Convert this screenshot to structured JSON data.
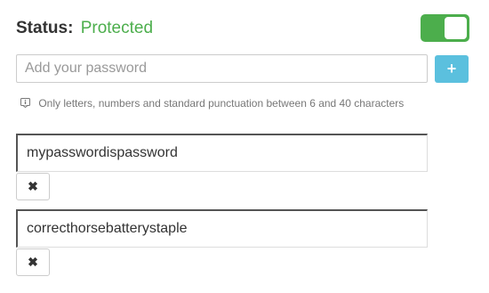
{
  "status": {
    "label": "Status:",
    "value": "Protected",
    "value_color": "#4cae4c",
    "toggle_on": true,
    "toggle_color": "#4cae4c"
  },
  "add_password": {
    "placeholder": "Add your password",
    "value": "",
    "button_icon": "plus-icon",
    "button_glyph": "+",
    "button_color": "#5bc0de"
  },
  "hint": {
    "icon": "info-icon",
    "text": "Only letters, numbers and standard punctuation between 6 and 40 characters"
  },
  "passwords": [
    {
      "value": "mypasswordispassword",
      "remove_icon": "close-icon",
      "remove_glyph": "✖"
    },
    {
      "value": "correcthorsebatterystaple",
      "remove_icon": "close-icon",
      "remove_glyph": "✖"
    }
  ]
}
